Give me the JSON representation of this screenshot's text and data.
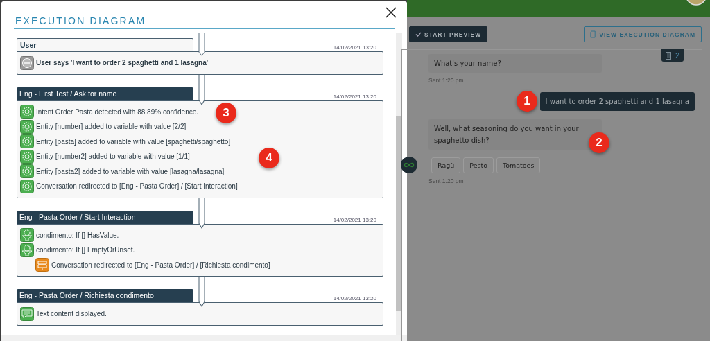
{
  "dialog": {
    "title": "EXECUTION DIAGRAM",
    "blocks": [
      {
        "kind": "user",
        "title": "User",
        "timestamp": "14/02/2021 13:20",
        "items": [
          {
            "kind": "chat",
            "text": "User says 'I want to order 2 spaghetti and 1 lasagna'"
          }
        ]
      },
      {
        "kind": "step",
        "title": "Eng - First Test / Ask for name",
        "timestamp": "14/02/2021 13:20",
        "items": [
          {
            "kind": "gear",
            "text": "Intent Order Pasta detected with 88.89% confidence."
          },
          {
            "kind": "gear",
            "text": "Entity [number] added to variable with value [2/2]"
          },
          {
            "kind": "gear",
            "text": "Entity [pasta] added to variable with value [spaghetti/spaghetto]"
          },
          {
            "kind": "gear",
            "text": "Entity [number2] added to variable with value [1/1]"
          },
          {
            "kind": "gear",
            "text": "Entity [pasta2] added to variable with value [lasagna/lasagna]"
          },
          {
            "kind": "gear",
            "text": "Conversation redirected to [Eng - Pasta Order] / [Start Interaction]"
          }
        ]
      },
      {
        "kind": "step",
        "title": "Eng - Pasta Order / Start Interaction",
        "timestamp": "14/02/2021 13:20",
        "items": [
          {
            "kind": "filter",
            "text": "condimento: If [] HasValue."
          },
          {
            "kind": "filter",
            "text": "condimento: If [] EmptyOrUnset.",
            "children": [
              {
                "kind": "signpost",
                "text": "Conversation redirected to [Eng - Pasta Order] / [Richiesta condimento]"
              }
            ]
          }
        ]
      },
      {
        "kind": "step",
        "title": "Eng - Pasta Order / Richiesta condimento",
        "timestamp": "14/02/2021 13:20",
        "items": [
          {
            "kind": "message",
            "text": "Text content displayed."
          }
        ]
      }
    ]
  },
  "toolbar": {
    "buttons": [
      {
        "kind": "primary",
        "label": "START PREVIEW"
      },
      {
        "kind": "outline",
        "label": "VIEW EXECUTION DIAGRAM"
      }
    ]
  },
  "chat": {
    "badge": "2",
    "messages": [
      {
        "kind": "bot",
        "text": "What's your name?",
        "time": "Sent 1:20 pm"
      },
      {
        "kind": "user",
        "text": "I  want to order 2 spaghetti and 1 lasagna"
      },
      {
        "kind": "bot",
        "text": "Well, what seasoning do you want in your spaghetto dish?",
        "choices": [
          "Ragù",
          "Pesto",
          "Tomatoes"
        ],
        "time": "Sent 1:20 pm"
      }
    ]
  },
  "markers": [
    "1",
    "2",
    "3",
    "4"
  ]
}
